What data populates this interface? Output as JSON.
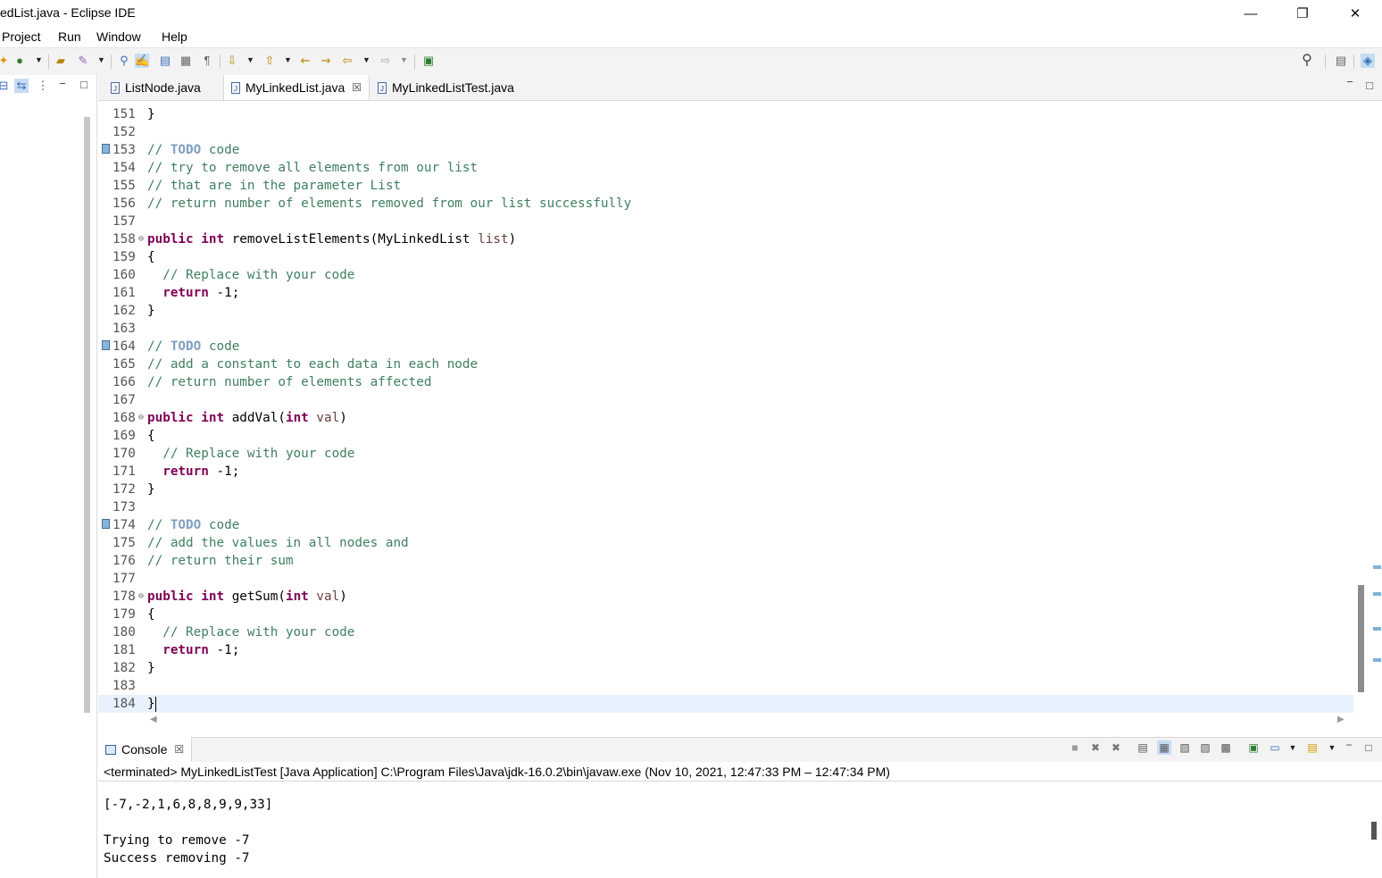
{
  "window": {
    "title": "edList.java - Eclipse IDE",
    "minimize": "—",
    "restore": "❐",
    "close": "✕"
  },
  "menu": [
    "Project",
    "Run",
    "Window",
    "Help"
  ],
  "tabs": [
    {
      "label": "ListNode.java"
    },
    {
      "label": "MyLinkedList.java",
      "close": "☒"
    },
    {
      "label": "MyLinkedListTest.java"
    }
  ],
  "editor": {
    "lines": [
      {
        "n": "151",
        "text": "}"
      },
      {
        "n": "152",
        "text": ""
      },
      {
        "n": "153",
        "text": "// TODO code"
      },
      {
        "n": "154",
        "text": "// try to remove all elements from our list"
      },
      {
        "n": "155",
        "text": "// that are in the parameter List"
      },
      {
        "n": "156",
        "text": "// return number of elements removed from our list successfully"
      },
      {
        "n": "157",
        "text": ""
      },
      {
        "n": "158",
        "text": "public int removeListElements(MyLinkedList list)"
      },
      {
        "n": "159",
        "text": "{"
      },
      {
        "n": "160",
        "text": "  // Replace with your code"
      },
      {
        "n": "161",
        "text": "  return -1;"
      },
      {
        "n": "162",
        "text": "}"
      },
      {
        "n": "163",
        "text": ""
      },
      {
        "n": "164",
        "text": "// TODO code"
      },
      {
        "n": "165",
        "text": "// add a constant to each data in each node"
      },
      {
        "n": "166",
        "text": "// return number of elements affected"
      },
      {
        "n": "167",
        "text": ""
      },
      {
        "n": "168",
        "text": "public int addVal(int val)"
      },
      {
        "n": "169",
        "text": "{"
      },
      {
        "n": "170",
        "text": "  // Replace with your code"
      },
      {
        "n": "171",
        "text": "  return -1;"
      },
      {
        "n": "172",
        "text": "}"
      },
      {
        "n": "173",
        "text": ""
      },
      {
        "n": "174",
        "text": "// TODO code"
      },
      {
        "n": "175",
        "text": "// add the values in all nodes and"
      },
      {
        "n": "176",
        "text": "// return their sum"
      },
      {
        "n": "177",
        "text": ""
      },
      {
        "n": "178",
        "text": "public int getSum(int val)"
      },
      {
        "n": "179",
        "text": "{"
      },
      {
        "n": "180",
        "text": "  // Replace with your code"
      },
      {
        "n": "181",
        "text": "  return -1;"
      },
      {
        "n": "182",
        "text": "}"
      },
      {
        "n": "183",
        "text": ""
      },
      {
        "n": "184",
        "text": "}"
      }
    ]
  },
  "console": {
    "tab_label": "Console",
    "tab_close": "☒",
    "status": "<terminated> MyLinkedListTest [Java Application] C:\\Program Files\\Java\\jdk-16.0.2\\bin\\javaw.exe  (Nov 10, 2021, 12:47:33 PM – 12:47:34 PM)",
    "output": [
      "[-7,-2,1,6,8,8,9,9,33]",
      "",
      "Trying to remove -7",
      "Success removing -7"
    ]
  },
  "colors": {
    "keyword": "#7f0055",
    "comment": "#3f7f5f",
    "todo": "#7f9fbf",
    "ruler": "#4f95c9"
  }
}
